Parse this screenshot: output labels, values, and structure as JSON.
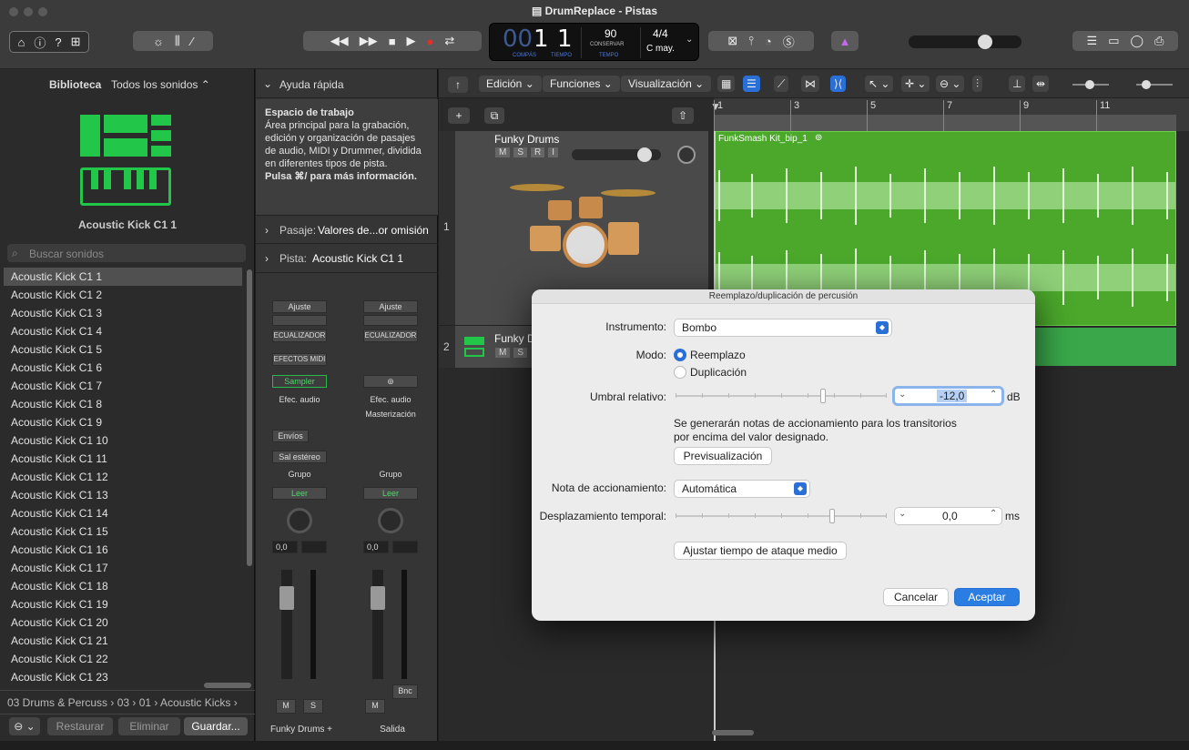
{
  "window": {
    "title": "DrumReplace - Pistas"
  },
  "lcd": {
    "bar": "1",
    "beat": "1",
    "bar_label": "COMPÁS",
    "beat_label": "TIEMPO",
    "tempo": "90",
    "tempo_mode": "CONSERVAR",
    "tempo_label": "TEMPO",
    "time_sig": "4/4",
    "key": "C may.",
    "prefix": "00"
  },
  "library": {
    "title": "Biblioteca",
    "filter": "Todos los sonidos ⌃",
    "selected_name": "Acoustic Kick C1 1",
    "search_placeholder": "Buscar sonidos",
    "items": [
      "Acoustic Kick C1 1",
      "Acoustic Kick C1 2",
      "Acoustic Kick C1 3",
      "Acoustic Kick C1 4",
      "Acoustic Kick C1 5",
      "Acoustic Kick C1 6",
      "Acoustic Kick C1 7",
      "Acoustic Kick C1 8",
      "Acoustic Kick C1 9",
      "Acoustic Kick C1 10",
      "Acoustic Kick C1 11",
      "Acoustic Kick C1 12",
      "Acoustic Kick C1 13",
      "Acoustic Kick C1 14",
      "Acoustic Kick C1 15",
      "Acoustic Kick C1 16",
      "Acoustic Kick C1 17",
      "Acoustic Kick C1 18",
      "Acoustic Kick C1 19",
      "Acoustic Kick C1 20",
      "Acoustic Kick C1 21",
      "Acoustic Kick C1 22",
      "Acoustic Kick C1 23"
    ],
    "path": "03 Drums & Percuss › 03 › 01 › Acoustic Kicks ›",
    "restore": "Restaurar",
    "delete": "Eliminar",
    "save": "Guardar..."
  },
  "quickhelp": {
    "title": "Ayuda rápida",
    "heading": "Espacio de trabajo",
    "body": "Área principal para la grabación, edición y organización de pasajes de audio, MIDI y Drummer, dividida en diferentes tipos de pista.",
    "hint": "Pulsa ⌘/ para más información."
  },
  "inspector": {
    "region_label": "Pasaje:",
    "region_value": "Valores de...or omisión",
    "track_label": "Pista:",
    "track_value": "Acoustic Kick C1 1",
    "ch1": {
      "setting": "Ajuste",
      "eq": "ECUALIZADOR",
      "midi_fx": "EFECTOS MIDI",
      "instrument": "Sampler",
      "audio_fx": "Efec. audio",
      "sends": "Envíos",
      "output": "Sal estéreo",
      "group": "Grupo",
      "automation": "Leer",
      "vol": "0,0",
      "name": "Funky Drums +",
      "m": "M",
      "s": "S"
    },
    "ch2": {
      "setting": "Ajuste",
      "eq": "ECUALIZADOR",
      "audio_fx": "Efec. audio",
      "mastering": "Masterización",
      "group": "Grupo",
      "automation": "Leer",
      "vol": "0,0",
      "bnc": "Bnc",
      "name": "Salida",
      "m": "M"
    },
    "scale": [
      "0",
      "3",
      "6",
      "9",
      "12",
      "15",
      "18",
      "21",
      "24",
      "30",
      "35",
      "40",
      "45",
      "50",
      "60"
    ]
  },
  "toolbar": {
    "edit": "Edición",
    "functions": "Funciones",
    "view": "Visualización"
  },
  "ruler": [
    "1",
    "3",
    "5",
    "7",
    "9",
    "11"
  ],
  "tracks": [
    {
      "num": "1",
      "name": "Funky Drums",
      "btns": [
        "M",
        "S",
        "R",
        "I"
      ]
    },
    {
      "num": "2",
      "name": "Funky Drums",
      "btns": [
        "M",
        "S"
      ]
    }
  ],
  "region": {
    "name": "FunkSmash Kit_bip_1"
  },
  "colors": {
    "region": "#4ba82b",
    "accent": "#2a6fd6",
    "lcd_label": "#4b7ad8",
    "logo": "#22c749"
  },
  "dialog": {
    "title": "Reemplazo/duplicación de percusión",
    "instrument_label": "Instrumento:",
    "instrument_value": "Bombo",
    "mode_label": "Modo:",
    "mode_replace": "Reemplazo",
    "mode_duplicate": "Duplicación",
    "threshold_label": "Umbral relativo:",
    "threshold_value": "-12,0",
    "threshold_unit": "dB",
    "info": "Se generarán notas de accionamiento para los transitorios por encima del valor designado.",
    "preview": "Previsualización",
    "trigger_label": "Nota de accionamiento:",
    "trigger_value": "Automática",
    "offset_label": "Desplazamiento temporal:",
    "offset_value": "0,0",
    "offset_unit": "ms",
    "adjust": "Ajustar tiempo de ataque medio",
    "cancel": "Cancelar",
    "ok": "Aceptar"
  }
}
